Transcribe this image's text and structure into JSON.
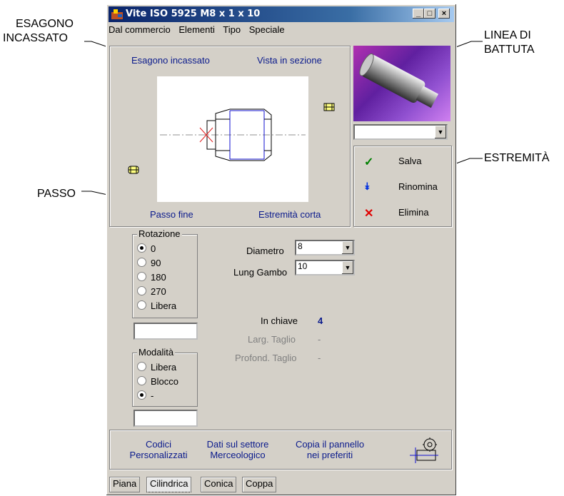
{
  "callouts": {
    "esagono_line1": "ESAGONO",
    "esagono_line2": "INCASSATO",
    "linea_line1": "LINEA DI",
    "linea_line2": "BATTUTA",
    "estremita": "ESTREMITÀ",
    "passo": "PASSO"
  },
  "window": {
    "title": "Vite ISO 5925 M8 x 1 x 10",
    "controls": [
      "_",
      "□",
      "×"
    ]
  },
  "menu": [
    "Dal commercio",
    "Elementi",
    "Tipo",
    "Speciale"
  ],
  "preview": {
    "top_left": "Esagono incassato",
    "top_right": "Vista in sezione",
    "bottom_left": "Passo fine",
    "bottom_right": "Estremità corta"
  },
  "side_actions": [
    {
      "label": "Salva",
      "icon": "check-icon",
      "color": "#008000"
    },
    {
      "label": "Rinomina",
      "icon": "double-chevron-down-icon",
      "color": "#0030e0"
    },
    {
      "label": "Elimina",
      "icon": "x-icon",
      "color": "#e00000"
    }
  ],
  "rotazione": {
    "title": "Rotazione",
    "options": [
      "0",
      "90",
      "180",
      "270",
      "Libera"
    ],
    "selected": "0"
  },
  "modalita": {
    "title": "Modalità",
    "options": [
      "Libera",
      "Blocco",
      "-"
    ],
    "selected": "-"
  },
  "fields": {
    "diametro_label": "Diametro",
    "diametro_value": "8",
    "lung_gambo_label": "Lung Gambo",
    "lung_gambo_value": "10"
  },
  "info": {
    "in_chiave_label": "In chiave",
    "in_chiave_value": "4",
    "larg_taglio_label": "Larg. Taglio",
    "larg_taglio_value": "-",
    "profond_taglio_label": "Profond. Taglio",
    "profond_taglio_value": "-"
  },
  "bottom_links": {
    "codici_1": "Codici",
    "codici_2": "Personalizzati",
    "dati_1": "Dati sul settore",
    "dati_2": "Merceologico",
    "copia_1": "Copia il pannello",
    "copia_2": "nei preferiti"
  },
  "tabs": [
    "Piana",
    "Cilindrica",
    "Conica",
    "Coppa"
  ],
  "active_tab": "Cilindrica"
}
